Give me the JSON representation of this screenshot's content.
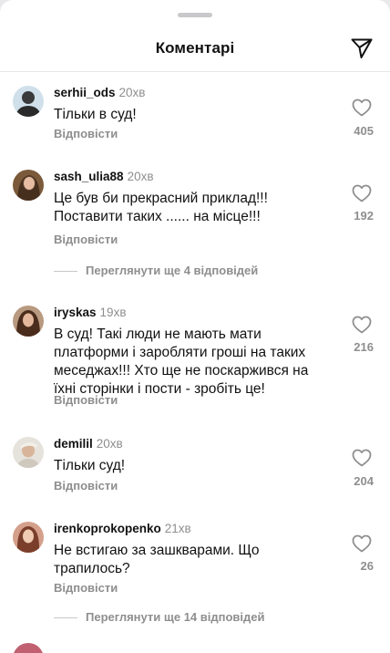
{
  "header": {
    "title": "Коментарі",
    "send_icon": "paper-plane-icon"
  },
  "comments": [
    {
      "username": "serhii_ods",
      "time": "20хв",
      "text": "Тільки в суд!",
      "reply": "Відповісти",
      "likes": "405"
    },
    {
      "username": "sash_ulia88",
      "time": "20хв",
      "text": "Це був би прекрасний приклад!!!\nПоставити таких ...... на місце!!!",
      "reply": "Відповісти",
      "likes": "192",
      "view_replies": "Переглянути ще 4 відповідей"
    },
    {
      "username": "iryskas",
      "time": "19хв",
      "text": "В суд! Такі люди не мають мати платформи і заробляти гроші на таких меседжах!!! Хто ще не поскаржився на їхні сторінки і пости - зробіть це!",
      "reply": "Відповісти",
      "likes": "216"
    },
    {
      "username": "demilil",
      "time": "20хв",
      "text": "Тільки суд!",
      "reply": "Відповісти",
      "likes": "204"
    },
    {
      "username": "irenkoprokopenko",
      "time": "21хв",
      "text": "Не встигаю за зашкварами. Що трапилось?",
      "reply": "Відповісти",
      "likes": "26",
      "view_replies": "Переглянути ще 14 відповідей"
    }
  ],
  "colors": {
    "secondary_text": "#8e8e8e",
    "divider": "#e6e6e6"
  }
}
